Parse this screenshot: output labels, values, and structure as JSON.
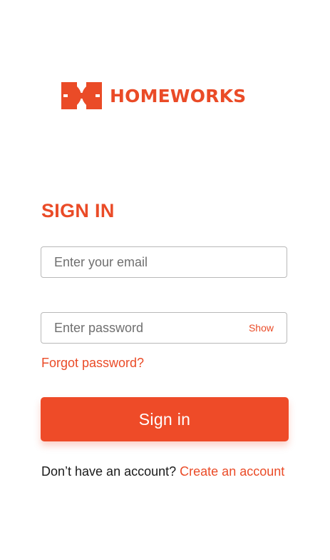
{
  "brand": {
    "name": "HOMEWORKS",
    "logo_icon": "homeworks-logo-mark",
    "color": "#ea4b27"
  },
  "signin": {
    "title": "SIGN IN",
    "email": {
      "value": "",
      "placeholder": "Enter your email"
    },
    "password": {
      "value": "",
      "placeholder": "Enter password",
      "toggle_label": "Show"
    },
    "forgot_label": "Forgot password?",
    "button_label": "Sign in",
    "button_color": "#ee4b28"
  },
  "footer": {
    "prompt": "Don’t have an account?",
    "link_label": "Create an account"
  }
}
